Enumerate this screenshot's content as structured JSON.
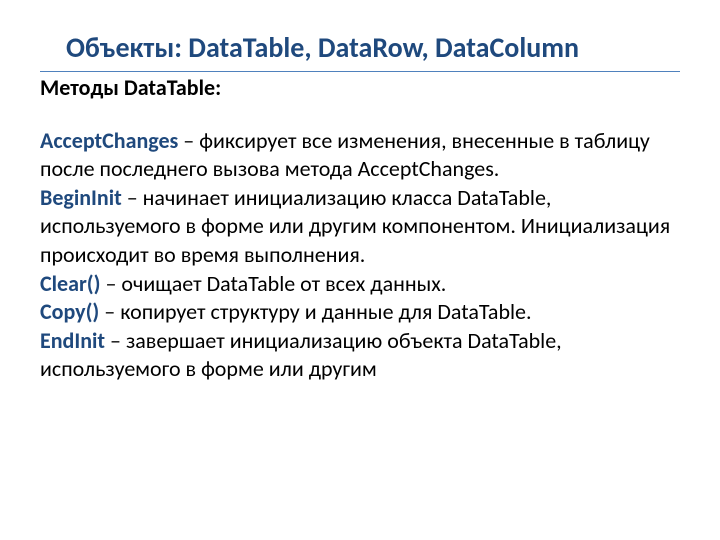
{
  "title": "Объекты: DataTable, DataRow, DataColumn",
  "subhead": "Методы DataTable:",
  "methods": [
    {
      "name": "AcceptChanges",
      "desc": " – фиксирует все изменения, внесенные в таблицу после последнего вызова метода AcceptChanges."
    },
    {
      "name": "BeginInit",
      "desc": " – начинает инициализацию класса DataTable, используемого в форме или другим компонентом. Инициализация происходит во время выполнения."
    },
    {
      "name": "Clear()",
      "desc": " – очищает DataTable от всех данных."
    },
    {
      "name": "Copy()",
      "desc": " – копирует структуру и данные для DataTable."
    },
    {
      "name": "EndInit",
      "desc": " – завершает инициализацию объекта DataTable, используемого в форме или другим"
    }
  ]
}
